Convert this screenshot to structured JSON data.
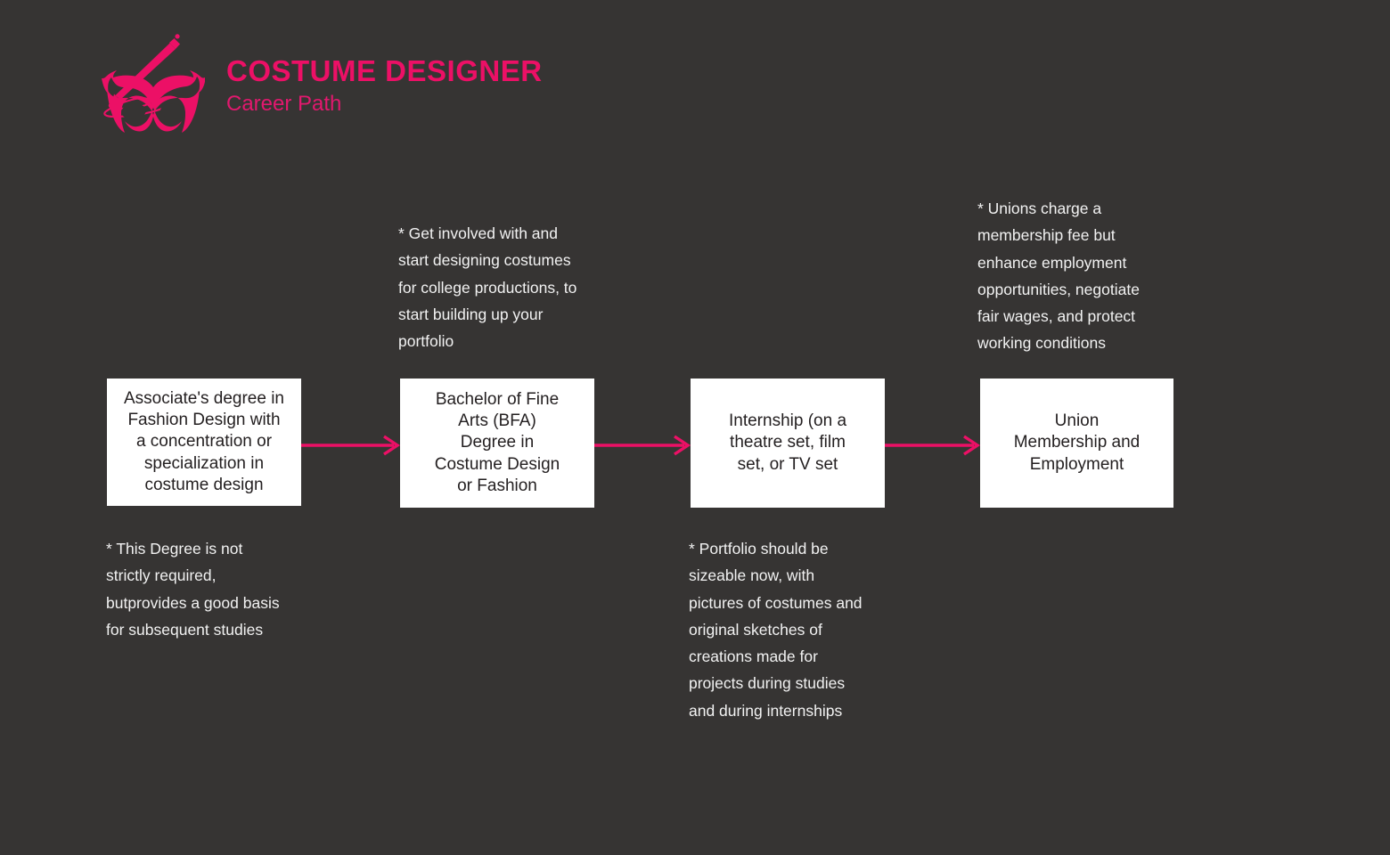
{
  "page": {
    "background_color": "#363433",
    "accent_color": "#EC1066",
    "box_fill_color": "#FFFFFF",
    "box_text_color": "#231F20",
    "annotation_text_color": "#F2F2F2"
  },
  "header": {
    "logo_name": "costume-mask-with-needle-and-thread",
    "title": "COSTUME DESIGNER",
    "subtitle": "Career Path"
  },
  "flow": {
    "steps": [
      {
        "id": "step-1",
        "text": "Associate's degree in\nFashion Design with\na concentration or\nspecialization in\ncostume design"
      },
      {
        "id": "step-2",
        "text": "Bachelor of Fine\nArts (BFA)\nDegree in\nCostume Design\nor Fashion"
      },
      {
        "id": "step-3",
        "text": "Internship (on a\ntheatre set, film\nset, or TV set"
      },
      {
        "id": "step-4",
        "text": "Union\nMembership and\nEmployment"
      }
    ],
    "connectors": [
      {
        "id": "arrow-1",
        "from": "step-1",
        "to": "step-2",
        "icon": "arrow-right-icon"
      },
      {
        "id": "arrow-2",
        "from": "step-2",
        "to": "step-3",
        "icon": "arrow-right-icon"
      },
      {
        "id": "arrow-3",
        "from": "step-3",
        "to": "step-4",
        "icon": "arrow-right-icon"
      }
    ]
  },
  "annotations": [
    {
      "id": "note-1",
      "relates_to": "step-1",
      "position": "below",
      "text": "* This Degree is not\nstrictly required,\nbutprovides a good basis\nfor subsequent studies"
    },
    {
      "id": "note-2",
      "relates_to": "step-2",
      "position": "above",
      "text": "* Get involved with and\nstart designing costumes\nfor college productions, to\nstart building up your\nportfolio"
    },
    {
      "id": "note-3",
      "relates_to": "step-3",
      "position": "below",
      "text": "* Portfolio should be\nsizeable now, with\npictures of costumes and\noriginal sketches of\ncreations made for\nprojects during studies\nand during internships"
    },
    {
      "id": "note-4",
      "relates_to": "step-4",
      "position": "above",
      "text": "* Unions charge a\nmembership fee but\nenhance employment\nopportunities, negotiate\nfair wages, and protect\nworking conditions"
    }
  ]
}
